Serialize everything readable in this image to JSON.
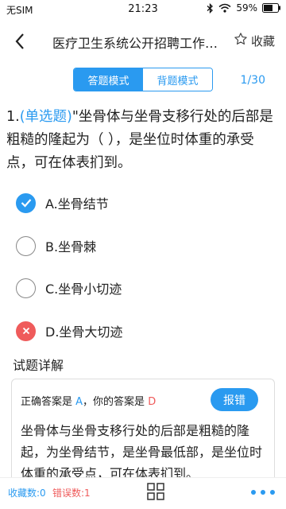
{
  "status_bar": {
    "carrier": "无SIM",
    "time": "21:23",
    "battery": "59%"
  },
  "header": {
    "back_icon": "chevron-left-icon",
    "title": "医疗卫生系统公开招聘工作人员考试题库",
    "favorite_label": "收藏",
    "favorite_icon": "star-outline-icon"
  },
  "mode": {
    "tabs": [
      {
        "label": "答题模式",
        "active": true
      },
      {
        "label": "背题模式",
        "active": false
      }
    ],
    "progress": "1/30"
  },
  "question": {
    "number": "1.",
    "type": "(单选题)",
    "text": "\"坐骨体与坐骨支移行处的后部是粗糙的隆起为（ ），是坐位时体重的承受点，可在体表扪到。"
  },
  "options": [
    {
      "label": "A.坐骨结节",
      "state": "correct"
    },
    {
      "label": "B.坐骨棘",
      "state": "none"
    },
    {
      "label": "C.坐骨小切迹",
      "state": "none"
    },
    {
      "label": "D.坐骨大切迹",
      "state": "wrong"
    }
  ],
  "explanation": {
    "title": "试题详解",
    "correct_prefix": "正确答案是 ",
    "correct_answer": "A",
    "user_prefix": "，你的答案是 ",
    "user_answer": "D",
    "report_label": "报错",
    "text": "坐骨体与坐骨支移行处的后部是粗糙的隆起，为坐骨结节，是坐骨最低部，是坐位时体重的承受点，可在体表扪到。"
  },
  "bottom_bar": {
    "favorites_count": "收藏数:0",
    "errors_count": "错误数:1",
    "grid_icon": "grid-icon",
    "more_icon": "more-dots-icon"
  },
  "colors": {
    "accent": "#2a9af0",
    "error": "#ef5b5b"
  }
}
